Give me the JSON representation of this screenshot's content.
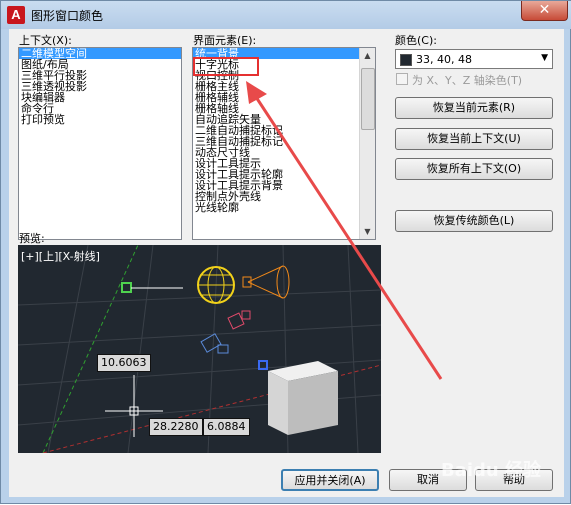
{
  "window": {
    "title": "图形窗口颜色",
    "close_label": "✕",
    "app_icon_letter": "A"
  },
  "context": {
    "label": "上下文(X):",
    "items": [
      "二维模型空间",
      "图纸/布局",
      "三维平行投影",
      "三维透视投影",
      "块编辑器",
      "命令行",
      "打印预览"
    ]
  },
  "elements": {
    "label": "界面元素(E):",
    "items": [
      "统一背景",
      "十字光标",
      "视口控制",
      "栅格主线",
      "栅格辅线",
      "栅格轴线",
      "自动追踪矢量",
      "二维自动捕捉标记",
      "三维自动捕捉标记",
      "动态尺寸线",
      "设计工具提示",
      "设计工具提示轮廓",
      "设计工具提示背景",
      "控制点外壳线",
      "光线轮廓"
    ]
  },
  "color": {
    "label": "颜色(C):",
    "value": "33, 40, 48",
    "swatch": "#212830",
    "tint_label": "为 X、Y、Z 轴染色(T)"
  },
  "buttons": {
    "restore_element": "恢复当前元素(R)",
    "restore_context": "恢复当前上下文(U)",
    "restore_all": "恢复所有上下文(O)",
    "restore_classic": "恢复传统颜色(L)",
    "apply_close": "应用并关闭(A)",
    "cancel": "取消",
    "help": "帮助"
  },
  "preview": {
    "label": "预览:",
    "viewport_label": "[+][上][X-射线]",
    "dim1": "10.6063",
    "dim2": "28.2280",
    "dim3": "6.0884"
  },
  "watermark": "Baidu 经验"
}
